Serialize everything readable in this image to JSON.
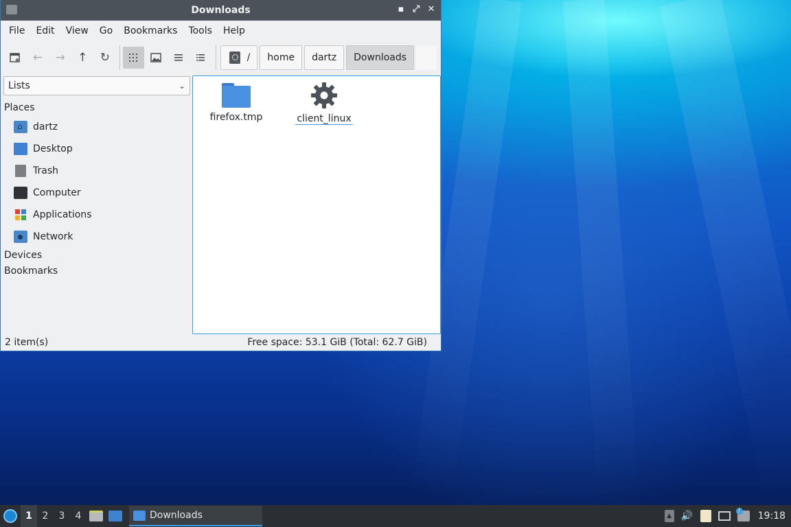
{
  "window": {
    "title": "Downloads",
    "controls": [
      "minimize",
      "maximize",
      "close"
    ]
  },
  "menubar": {
    "items": [
      "File",
      "Edit",
      "View",
      "Go",
      "Bookmarks",
      "Tools",
      "Help"
    ]
  },
  "toolbar": {
    "buttons": [
      "new-tab-icon",
      "back-icon",
      "forward-icon",
      "up-icon",
      "reload-icon",
      "icon-view-icon",
      "thumbnail-view-icon",
      "compact-view-icon",
      "detailed-list-icon"
    ],
    "active_view": "icon-view-icon"
  },
  "path": {
    "root": "/",
    "segments": [
      "home",
      "dartz",
      "Downloads"
    ]
  },
  "sidebar": {
    "mode": "Lists",
    "places_title": "Places",
    "places": [
      {
        "label": "dartz",
        "icon": "home-folder-icon"
      },
      {
        "label": "Desktop",
        "icon": "desktop-icon"
      },
      {
        "label": "Trash",
        "icon": "trash-icon"
      },
      {
        "label": "Computer",
        "icon": "computer-icon"
      },
      {
        "label": "Applications",
        "icon": "applications-icon"
      },
      {
        "label": "Network",
        "icon": "network-icon"
      }
    ],
    "devices_title": "Devices",
    "bookmarks_title": "Bookmarks"
  },
  "files": [
    {
      "name": "firefox.tmp",
      "icon": "folder-icon"
    },
    {
      "name": "client_linux",
      "icon": "gear-icon"
    }
  ],
  "status": {
    "count": "2 item(s)",
    "free_space": "Free space: 53.1 GiB (Total: 62.7 GiB)"
  },
  "taskbar": {
    "workspaces": [
      "1",
      "2",
      "3",
      "4"
    ],
    "active_workspace": "1",
    "task_label": "Downloads",
    "clock": "19:18"
  },
  "colors": {
    "accent": "#3d9ee8",
    "titlebar": "#4b5259",
    "taskbar": "#2b2f33",
    "folder": "#4a90e0"
  }
}
